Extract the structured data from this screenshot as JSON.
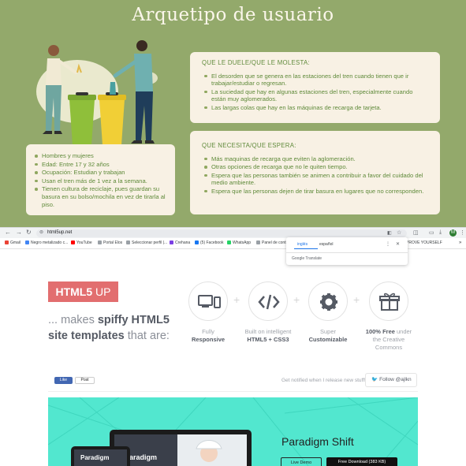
{
  "slide": {
    "title": "Arquetipo de usuario",
    "profile": [
      "Hombres y mujeres",
      "Edad: Entre 17 y 32 años",
      "Ocupación: Estudian y trabajan",
      "Usan el tren más de 1 vez a la semana.",
      "Tienen cultura de reciclaje, pues guardan su basura en su bolso/mochila en vez de tirarla al piso."
    ],
    "pains": {
      "heading": "QUE LE DUELE/QUE LE MOLESTA:",
      "items": [
        "El desorden que se genera en las estaciones del tren cuando tienen que ir trabajar/estudiar o regresan.",
        "La suciedad que hay en algunas estaciones del tren, especialmente cuando están muy aglomerados.",
        "Las largas colas que hay en las máquinas de recarga de tarjeta."
      ]
    },
    "needs": {
      "heading": "QUE NECESITA/QUE ESPERA:",
      "items": [
        "Más maquinas de recarga que eviten la aglomeración.",
        "Otras opciones de recarga que no le quiten tiempo.",
        "Espera que las personas también se animen a contribuir a favor del cuidado del medio ambiente.",
        "Espera que las personas dejen de tirar basura en lugares que no corresponden."
      ]
    },
    "colors": {
      "background": "#93a96b",
      "card": "#f8f1e4",
      "text": "#5f8a3a"
    }
  },
  "browser": {
    "url": "html5up.net",
    "avatar_letter": "M",
    "bookmarks": [
      {
        "label": "Gmail",
        "color": "#ea4335"
      },
      {
        "label": "Negro metalizado c...",
        "color": "#4285f4"
      },
      {
        "label": "YouTube",
        "color": "#ff0000"
      },
      {
        "label": "Portal Elos",
        "color": "#9aa0a6"
      },
      {
        "label": "Seleccionar perfil |...",
        "color": "#9aa0a6"
      },
      {
        "label": "Crehana",
        "color": "#7b3fe4"
      },
      {
        "label": "(5) Facebook",
        "color": "#1877f2"
      },
      {
        "label": "WhatsApp",
        "color": "#25d366"
      },
      {
        "label": "Panel de contr",
        "color": "#9aa0a6"
      },
      {
        "label": "PROVE YOURSELF",
        "color": "#9aa0a6"
      }
    ],
    "translate": {
      "lang_from": "inglés",
      "lang_to": "español",
      "footer": "Google Translate"
    }
  },
  "page": {
    "logo_bold": "HTML5",
    "logo_rest": " UP",
    "tagline": {
      "p1": "... makes ",
      "b1": "spiffy HTML5",
      "b2": "site templates",
      "p2": " that are:"
    },
    "features": [
      {
        "icon": "monitor-phone-icon",
        "light": "Fully",
        "bold": "Responsive",
        "tail": ""
      },
      {
        "icon": "code-icon",
        "light": "Built on intelligent",
        "bold": "HTML5 + CSS3",
        "tail": ""
      },
      {
        "icon": "gear-icon",
        "light": "Super",
        "bold": "Customizable",
        "tail": ""
      },
      {
        "icon": "gift-icon",
        "light": "",
        "bold": "100% Free",
        "tail": " under the Creative Commons"
      }
    ],
    "social": {
      "like": "Like",
      "post": "Post"
    },
    "notify": "Get notified when I release new stuff!",
    "follow": "Follow @ajlkn",
    "banner": {
      "title": "Paradigm Shift",
      "device_title_laptop": "Paradigm",
      "device_title_phone": "Paradigm",
      "btn_demo": "Live Demo",
      "btn_download": "Free Download (383 KB)"
    },
    "colors": {
      "logo": "#e26e6f",
      "banner": "#52e7cf"
    }
  }
}
